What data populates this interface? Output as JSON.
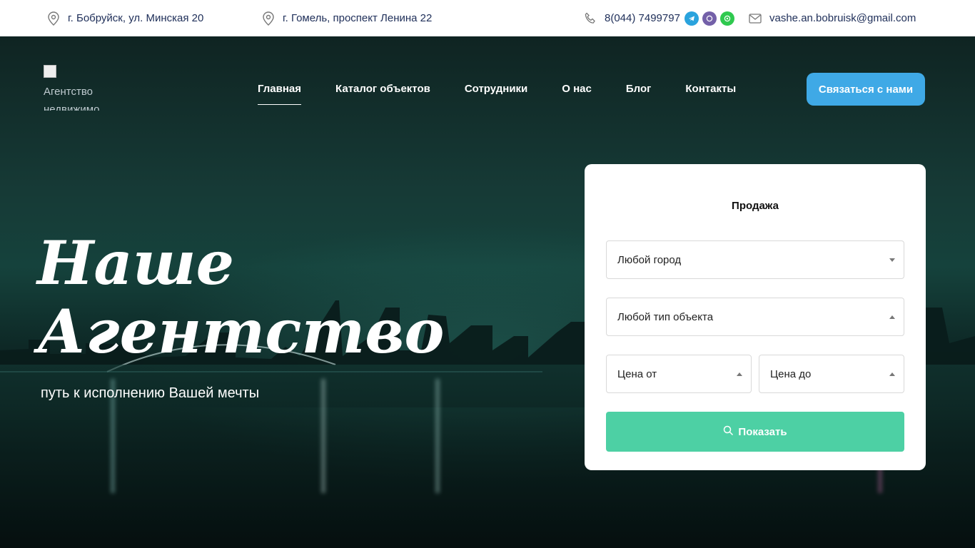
{
  "topbar": {
    "address1": "г. Бобруйск, ул. Минская 20",
    "address2": "г. Гомель, проспект Ленина 22",
    "phone": "8(044) 7499797",
    "email": "vashe.an.bobruisk@gmail.com",
    "messengers": [
      "telegram-icon",
      "viber-icon",
      "whatsapp-icon"
    ]
  },
  "logo": {
    "alt": "Агентство недвижимости"
  },
  "nav": {
    "items": [
      "Главная",
      "Каталог объектов",
      "Сотрудники",
      "О нас",
      "Блог",
      "Контакты"
    ],
    "active": "Главная",
    "cta": "Связаться с нами"
  },
  "hero": {
    "title_line1": "Наше",
    "title_line2": "Агентство",
    "subtitle": "путь к исполнению Вашей мечты"
  },
  "search": {
    "title": "Продажа",
    "city": "Любой город",
    "type": "Любой тип объекта",
    "price_from": "Цена от",
    "price_to": "Цена до",
    "submit": "Показать"
  },
  "colors": {
    "accent_blue": "#3fa9e6",
    "accent_green": "#4dd0a4",
    "topbar_text": "#20305a"
  }
}
